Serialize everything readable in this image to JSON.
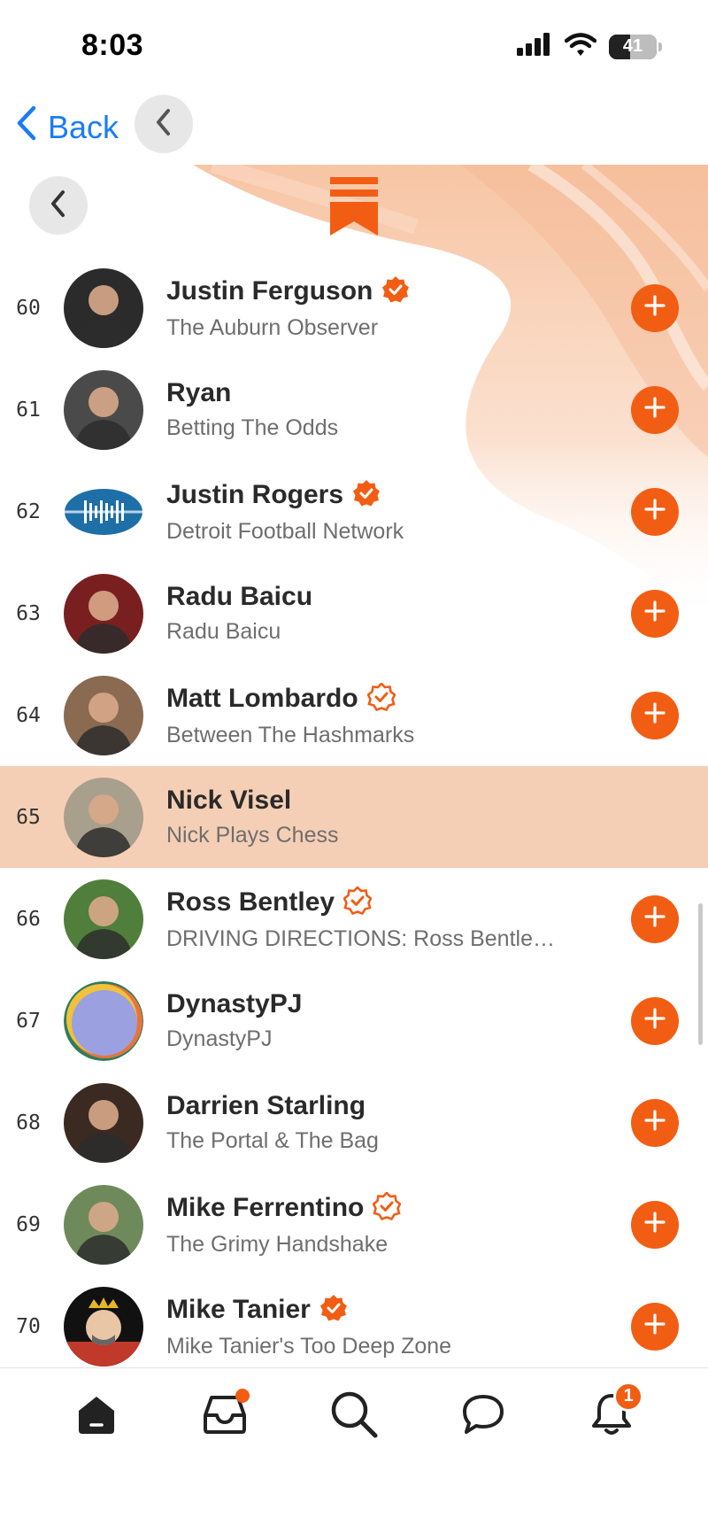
{
  "status_bar": {
    "time": "8:03",
    "battery": "41"
  },
  "nav": {
    "back_label": "Back"
  },
  "colors": {
    "accent": "#f25d14",
    "highlight": "#f5cfb5",
    "link": "#1a7cf5"
  },
  "list": {
    "items": [
      {
        "rank": "60",
        "name": "Justin Ferguson",
        "publication": "The Auburn Observer",
        "verified": "filled",
        "avatar_icon": "avatar-photo",
        "avatar_color": "#2b2b2b"
      },
      {
        "rank": "61",
        "name": "Ryan",
        "publication": "Betting The Odds",
        "verified": "none",
        "avatar_icon": "avatar-photo",
        "avatar_color": "#4a4a4a"
      },
      {
        "rank": "62",
        "name": "Justin Rogers",
        "publication": "Detroit Football Network",
        "verified": "filled",
        "avatar_icon": "football-logo",
        "avatar_color": "#1e6fa8"
      },
      {
        "rank": "63",
        "name": "Radu Baicu",
        "publication": "Radu Baicu",
        "verified": "none",
        "avatar_icon": "avatar-photo",
        "avatar_color": "#7a1f1f"
      },
      {
        "rank": "64",
        "name": "Matt Lombardo",
        "publication": "Between The Hashmarks",
        "verified": "outline",
        "avatar_icon": "avatar-photo",
        "avatar_color": "#8a6a50"
      },
      {
        "rank": "65",
        "name": "Nick Visel",
        "publication": "Nick Plays Chess",
        "verified": "none",
        "avatar_icon": "avatar-photo",
        "avatar_color": "#a8a08c",
        "highlighted": true
      },
      {
        "rank": "66",
        "name": "Ross Bentley",
        "publication": "DRIVING DIRECTIONS: Ross Bentle…",
        "verified": "outline",
        "avatar_icon": "avatar-photo",
        "avatar_color": "#4f7f3a"
      },
      {
        "rank": "67",
        "name": "DynastyPJ",
        "publication": "DynastyPJ",
        "verified": "none",
        "avatar_icon": "abstract-logo",
        "avatar_color": "#9aa0e0"
      },
      {
        "rank": "68",
        "name": "Darrien Starling",
        "publication": "The Portal & The Bag",
        "verified": "none",
        "avatar_icon": "avatar-photo",
        "avatar_color": "#3a2a22"
      },
      {
        "rank": "69",
        "name": "Mike Ferrentino",
        "publication": "The Grimy Handshake",
        "verified": "outline",
        "avatar_icon": "avatar-photo",
        "avatar_color": "#6f8a5a"
      },
      {
        "rank": "70",
        "name": "Mike Tanier",
        "publication": "Mike Tanier's Too Deep Zone",
        "verified": "filled",
        "avatar_icon": "cartoon-king-avatar",
        "avatar_color": "#c0392b"
      }
    ]
  },
  "tabs": [
    {
      "icon": "home-icon",
      "active": true
    },
    {
      "icon": "inbox-icon",
      "dot": true
    },
    {
      "icon": "search-icon"
    },
    {
      "icon": "chat-icon"
    },
    {
      "icon": "bell-icon",
      "badge": "1"
    }
  ]
}
